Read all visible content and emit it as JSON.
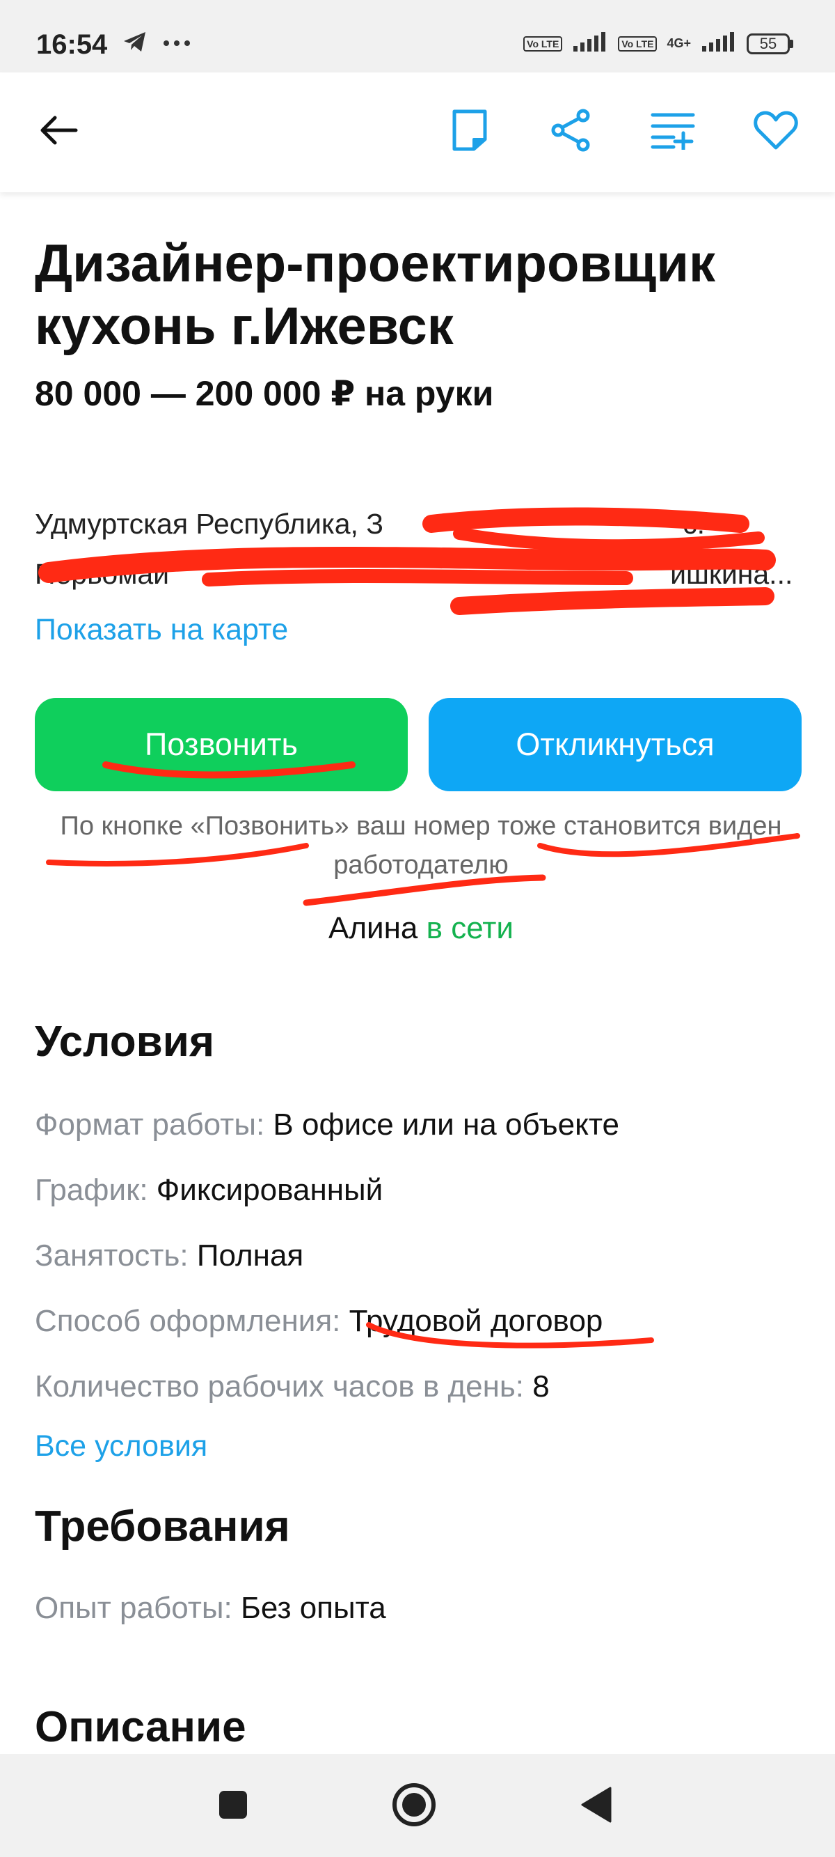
{
  "status_bar": {
    "time": "16:54",
    "volte": "Vo LTE",
    "network": "4G+",
    "battery": "55"
  },
  "toolbar": {
    "back_icon": "arrow-left-icon",
    "icons": [
      "note-icon",
      "share-icon",
      "list-add-icon",
      "heart-icon"
    ],
    "accent_color": "#1da1e8"
  },
  "vacancy": {
    "title": "Дизайнер-проектировщик кухонь г.Ижевск",
    "salary": "80 000 — 200 000 ₽ на руки",
    "address_line1": "Удмуртская Республика, З",
    "address_line2": "Первомай",
    "address_suffix1": "с.",
    "address_suffix2": "ишкина...",
    "map_link": "Показать на карте"
  },
  "actions": {
    "call_label": "Позвонить",
    "respond_label": "Откликнуться",
    "call_color": "#0fcf5c",
    "respond_color": "#0ea7f5",
    "note": "По кнопке «Позвонить» ваш номер тоже становится виден работодателю",
    "contact_name": "Алина",
    "contact_status": "в сети"
  },
  "conditions": {
    "heading": "Условия",
    "items": [
      {
        "label": "Формат работы:",
        "value": "В офисе или на объекте"
      },
      {
        "label": "График:",
        "value": "Фиксированный"
      },
      {
        "label": "Занятость:",
        "value": "Полная"
      },
      {
        "label": "Способ оформления:",
        "value": "Трудовой договор"
      },
      {
        "label": "Количество рабочих часов в день:",
        "value": "8"
      }
    ],
    "all_link": "Все условия"
  },
  "requirements": {
    "heading": "Требования",
    "items": [
      {
        "label": "Опыт работы:",
        "value": "Без опыта"
      }
    ]
  },
  "description": {
    "heading": "Описание"
  },
  "nav_bar": {
    "icons": [
      "square-icon",
      "circle-home-icon",
      "triangle-back-icon"
    ]
  }
}
